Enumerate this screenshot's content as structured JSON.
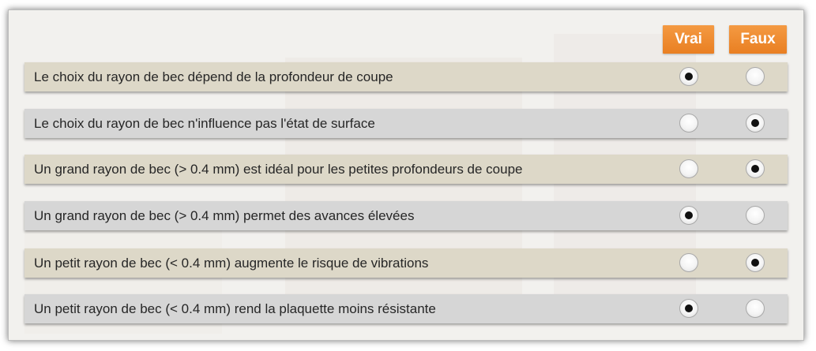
{
  "columns": {
    "true_label": "Vrai",
    "false_label": "Faux"
  },
  "colors": {
    "header_button": "#ef8a2e",
    "row_odd": "#ddd8c8",
    "row_even": "#d6d6d6"
  },
  "statements": [
    {
      "text": "Le choix du rayon de bec dépend de la profondeur de coupe",
      "answer": "vrai"
    },
    {
      "text": "Le choix du rayon de bec n'influence pas l'état de surface",
      "answer": "faux"
    },
    {
      "text": "Un grand rayon de bec (> 0.4 mm) est idéal pour les petites profondeurs de coupe",
      "answer": "faux"
    },
    {
      "text": "Un grand rayon de bec (> 0.4 mm) permet des avances élevées",
      "answer": "vrai"
    },
    {
      "text": "Un petit rayon de bec (< 0.4 mm) augmente le risque de vibrations",
      "answer": "faux"
    },
    {
      "text": "Un petit rayon de bec (< 0.4 mm) rend la plaquette moins résistante",
      "answer": "vrai"
    }
  ]
}
